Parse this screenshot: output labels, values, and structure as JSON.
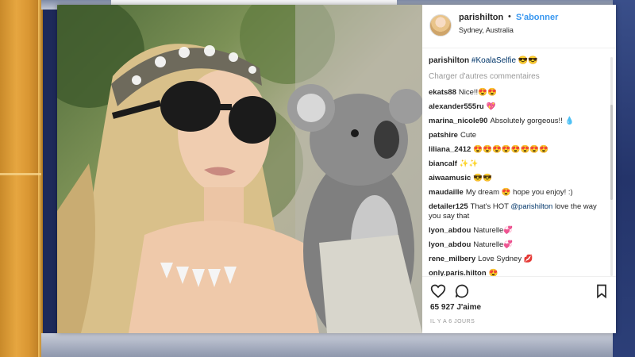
{
  "post": {
    "username": "parishilton",
    "separator": "•",
    "follow_label": "S'abonner",
    "location": "Sydney, Australia",
    "caption": {
      "username": "parishilton",
      "hashtag": "#KoalaSelfie",
      "emoji": "😎😎"
    },
    "load_more_label": "Charger d'autres commentaires",
    "comments": [
      {
        "user": "ekats88",
        "text": "Nice!!😍😍"
      },
      {
        "user": "alexander555ru",
        "text": "💖"
      },
      {
        "user": "marina_nicole90",
        "text": "Absolutely gorgeous!! 💧"
      },
      {
        "user": "patshire",
        "text": "Cute"
      },
      {
        "user": "liliana_2412",
        "text": "😍😍😍😍😍😍😍😍"
      },
      {
        "user": "biancalf",
        "text": "✨✨"
      },
      {
        "user": "aiwaamusic",
        "text": "😎😎"
      },
      {
        "user": "maudaille",
        "text": "My dream 😍 hope you enjoy! :)"
      },
      {
        "user": "detailer125",
        "text": "That's HOT",
        "mention": "@parishilton",
        "text2": "love the way you say that"
      },
      {
        "user": "lyon_abdou",
        "text": "Naturelle💞"
      },
      {
        "user": "lyon_abdou",
        "text": "Naturelle💞"
      },
      {
        "user": "rene_milbery",
        "text": "Love Sydney 💋"
      },
      {
        "user": "only.paris.hilton",
        "text": "😍"
      }
    ],
    "likes": "65 927 J'aime",
    "time": "IL Y A 6 JOURS",
    "icons": {
      "like": "heart-icon",
      "comment": "comment-bubble-icon",
      "save": "bookmark-icon"
    }
  }
}
